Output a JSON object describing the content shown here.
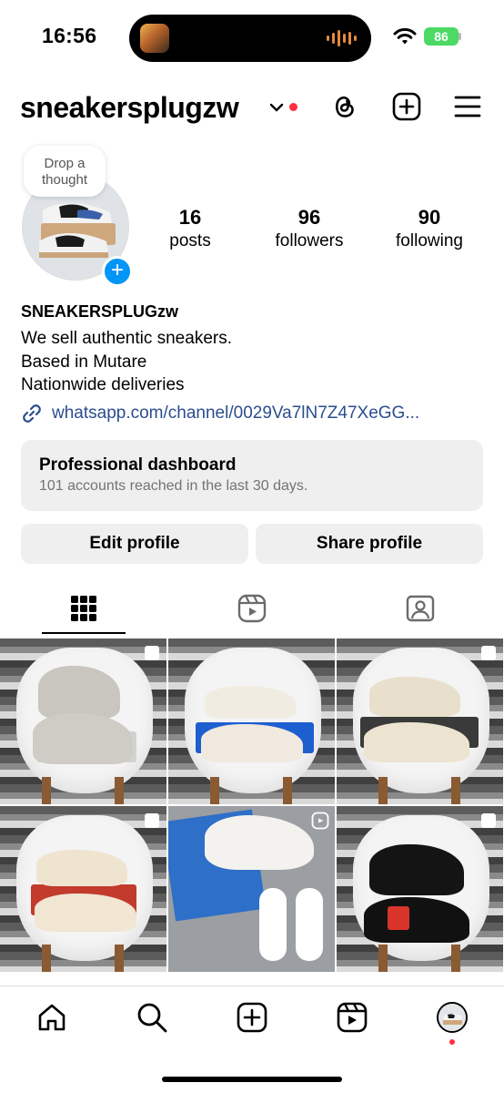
{
  "status_bar": {
    "time": "16:56",
    "battery": "86"
  },
  "header": {
    "username": "sneakersplugzw"
  },
  "profile": {
    "thought_bubble": [
      "Drop a",
      "thought"
    ],
    "stats": [
      {
        "value": "16",
        "label": "posts"
      },
      {
        "value": "96",
        "label": "followers"
      },
      {
        "value": "90",
        "label": "following"
      }
    ],
    "name": "SNEAKERSPLUGzw",
    "bio": [
      "We sell authentic sneakers.",
      "Based in Mutare",
      "Nationwide deliveries"
    ],
    "link": "whatsapp.com/channel/0029Va7lN7Z47XeGG..."
  },
  "dashboard": {
    "title": "Professional dashboard",
    "subtitle": "101 accounts reached in the last 30 days."
  },
  "buttons": {
    "edit": "Edit profile",
    "share": "Share profile"
  },
  "tabs": [
    "grid-icon",
    "reels-icon",
    "tagged-icon"
  ],
  "posts": [
    {
      "type": "carousel",
      "shoe": "grey high-top sneakers"
    },
    {
      "type": "image",
      "shoe": "cream low-top sneakers"
    },
    {
      "type": "carousel",
      "shoe": "cream running sneakers"
    },
    {
      "type": "carousel",
      "shoe": "cream and white sneakers"
    },
    {
      "type": "reel",
      "shoe": "white and gum sole sneakers"
    },
    {
      "type": "carousel",
      "shoe": "black high-top sneakers"
    }
  ],
  "colors": {
    "accent": "#0095f6",
    "notification": "#ff3040",
    "battery": "#4cd964",
    "surface": "#efefef"
  },
  "bottom_nav": [
    "home-icon",
    "search-icon",
    "create-icon",
    "reels-icon",
    "profile-avatar"
  ]
}
